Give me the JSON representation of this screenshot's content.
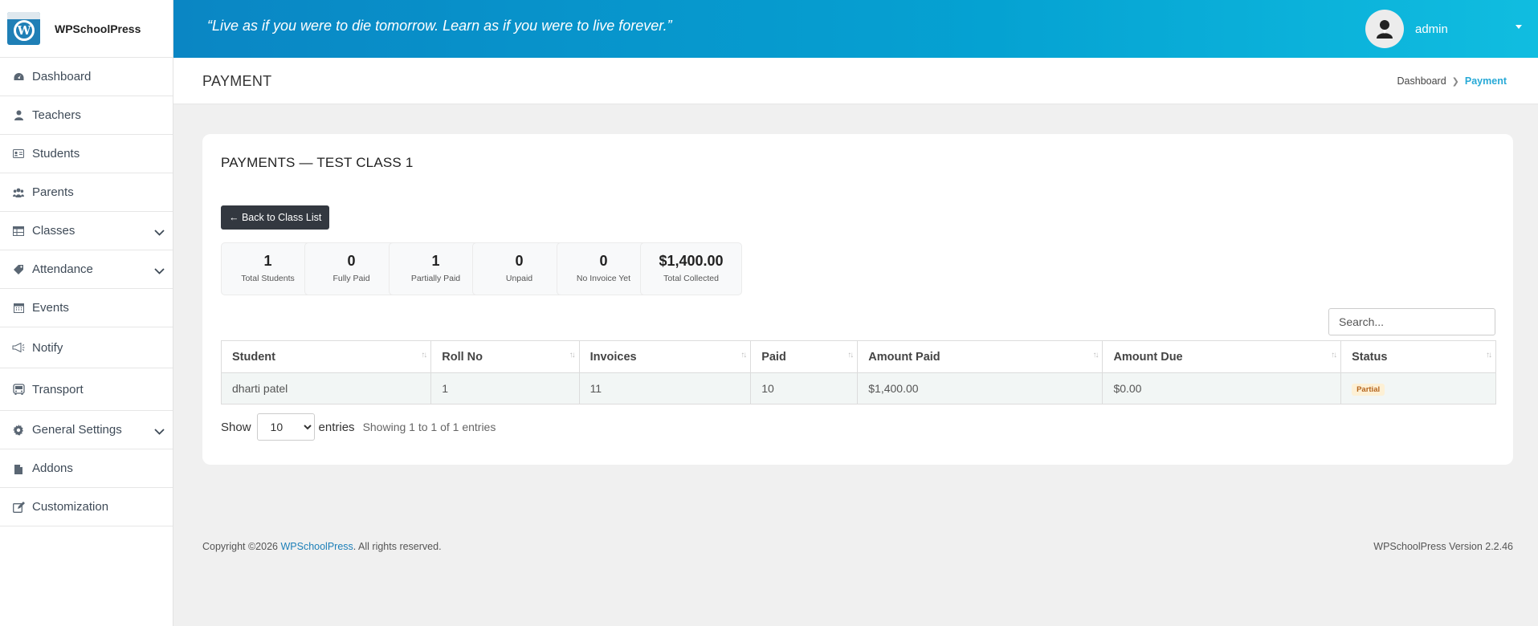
{
  "brand": {
    "name": "WPSchoolPress"
  },
  "sidebar": {
    "items": [
      {
        "label": "Dashboard",
        "icon": "dashboard-icon",
        "has_children": false
      },
      {
        "label": "Teachers",
        "icon": "teacher-icon",
        "has_children": false
      },
      {
        "label": "Students",
        "icon": "id-card-icon",
        "has_children": false
      },
      {
        "label": "Parents",
        "icon": "users-icon",
        "has_children": false
      },
      {
        "label": "Classes",
        "icon": "table-icon",
        "has_children": true
      },
      {
        "label": "Attendance",
        "icon": "tag-icon",
        "has_children": true
      },
      {
        "label": "Events",
        "icon": "calendar-icon",
        "has_children": false
      },
      {
        "label": "Notify",
        "icon": "megaphone-icon",
        "has_children": false
      },
      {
        "label": "Transport",
        "icon": "bus-icon",
        "has_children": false
      },
      {
        "label": "General Settings",
        "icon": "gear-icon",
        "has_children": true
      },
      {
        "label": "Addons",
        "icon": "addon-icon",
        "has_children": false
      },
      {
        "label": "Customization",
        "icon": "edit-icon",
        "has_children": false
      }
    ]
  },
  "header": {
    "quote": "“Live as if you were to die tomorrow. Learn as if you were to live forever.”",
    "user": "admin"
  },
  "page": {
    "title": "PAYMENT",
    "breadcrumb": [
      "Dashboard",
      "Payment"
    ]
  },
  "card": {
    "title": "PAYMENTS — TEST CLASS 1",
    "back_label": "← Back to Class List",
    "stats": [
      {
        "value": "1",
        "label": "Total Students"
      },
      {
        "value": "0",
        "label": "Fully Paid"
      },
      {
        "value": "1",
        "label": "Partially Paid"
      },
      {
        "value": "0",
        "label": "Unpaid"
      },
      {
        "value": "0",
        "label": "No Invoice Yet"
      },
      {
        "value": "$1,400.00",
        "label": "Total Collected"
      }
    ],
    "search_placeholder": "Search...",
    "table": {
      "headers": [
        "Student",
        "Roll No",
        "Invoices",
        "Paid",
        "Amount Paid",
        "Amount Due",
        "Status"
      ],
      "rows": [
        [
          "dharti patel",
          "1",
          "11",
          "10",
          "$1,400.00",
          "$0.00",
          "Partial"
        ]
      ]
    },
    "show_label": "Show",
    "entries_value": "10",
    "entries_label": "entries",
    "info": "Showing 1 to 1 of 1 entries"
  },
  "footer": {
    "copyright_prefix": "Copyright ©2026 ",
    "copyright_link": "WPSchoolPress",
    "copyright_suffix": ". All rights reserved.",
    "version": "WPSchoolPress Version 2.2.46"
  },
  "colors": {
    "header_start": "#0a86c4",
    "header_end": "#10bde0",
    "breadcrumb_active": "#27a9d6",
    "button_dark": "#333840",
    "badge_bg": "#fdf0d5",
    "badge_text": "#b5651d"
  }
}
